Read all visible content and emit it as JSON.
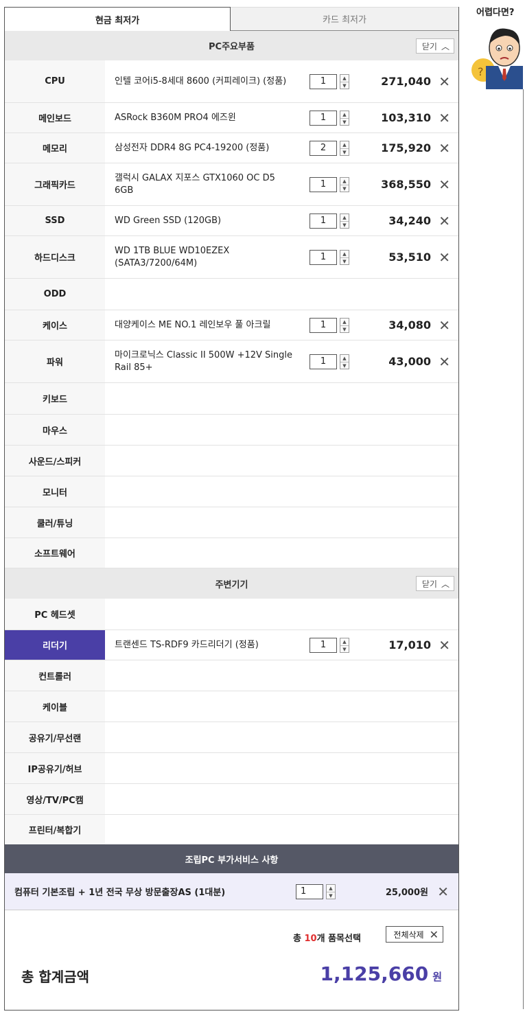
{
  "tabs": [
    "현금 최저가",
    "카드 최저가"
  ],
  "sections": [
    {
      "title": "PC주요부품",
      "close_label": "닫기",
      "rows": [
        {
          "cat": "CPU",
          "name": "인텔 코어i5-8세대 8600 (커피레이크) (정품)",
          "qty": "1",
          "price": "271,040",
          "h": 62
        },
        {
          "cat": "메인보드",
          "name": "ASRock B360M PRO4 에즈윈",
          "qty": "1",
          "price": "103,310",
          "h": 44
        },
        {
          "cat": "메모리",
          "name": "삼성전자 DDR4 8G PC4-19200 (정품)",
          "qty": "2",
          "price": "175,920",
          "h": 44
        },
        {
          "cat": "그래픽카드",
          "name": "갤럭시 GALAX 지포스 GTX1060 OC D5 6GB",
          "qty": "1",
          "price": "368,550",
          "h": 62
        },
        {
          "cat": "SSD",
          "name": "WD Green SSD (120GB)",
          "qty": "1",
          "price": "34,240",
          "h": 44
        },
        {
          "cat": "하드디스크",
          "name": "WD 1TB BLUE WD10EZEX (SATA3/7200/64M)",
          "qty": "1",
          "price": "53,510",
          "h": 62
        },
        {
          "cat": "ODD",
          "h": 46
        },
        {
          "cat": "케이스",
          "name": "대양케이스 ME NO.1 레인보우 풀 아크릴",
          "qty": "1",
          "price": "34,080",
          "h": 44
        },
        {
          "cat": "파워",
          "name": "마이크로닉스 Classic II 500W +12V Single Rail 85+",
          "qty": "1",
          "price": "43,000",
          "h": 62
        },
        {
          "cat": "키보드",
          "h": 46
        },
        {
          "cat": "마우스",
          "h": 45
        },
        {
          "cat": "사운드/스피커",
          "h": 45
        },
        {
          "cat": "모니터",
          "h": 45
        },
        {
          "cat": "쿨러/튜닝",
          "h": 45
        },
        {
          "cat": "소프트웨어",
          "h": 44
        }
      ]
    },
    {
      "title": "주변기기",
      "close_label": "닫기",
      "rows": [
        {
          "cat": "PC 헤드셋",
          "h": 46
        },
        {
          "cat": "리더기",
          "name": "트랜센드 TS-RDF9 카드리더기 (정품)",
          "qty": "1",
          "price": "17,010",
          "h": 44,
          "selected": true
        },
        {
          "cat": "컨트롤러",
          "h": 45
        },
        {
          "cat": "케이블",
          "h": 45
        },
        {
          "cat": "공유기/무선랜",
          "h": 45
        },
        {
          "cat": "IP공유기/허브",
          "h": 45
        },
        {
          "cat": "영상/TV/PC캠",
          "h": 45
        },
        {
          "cat": "프린터/복합기",
          "h": 43
        }
      ]
    }
  ],
  "service": {
    "title": "조립PC 부가서비스 사항",
    "name": "컴퓨터 기본조립 + 1년 전국 무상 방문출장AS (1대분)",
    "qty": "1",
    "price": "25,000원"
  },
  "summary": {
    "prefix": "총 ",
    "count": "10",
    "suffix": "개 품목선택",
    "delete_all": "전체삭제",
    "total_label": "총 합계금액",
    "total_value": "1,125,660",
    "unit": "원"
  },
  "helper": {
    "title": "어렵다면?"
  },
  "colors": {
    "accent": "#4a3fa6",
    "service_head": "#555866",
    "remove": "#e03030"
  }
}
